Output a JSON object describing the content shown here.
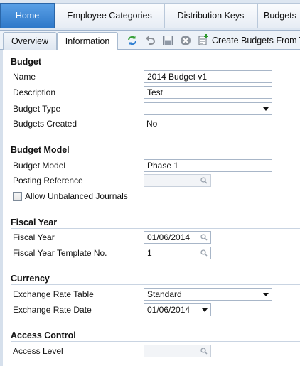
{
  "top_tabs": [
    "Home",
    "Employee Categories",
    "Distribution Keys",
    "Budgets"
  ],
  "sub_tabs": {
    "overview": "Overview",
    "information": "Information"
  },
  "toolbar": {
    "create_budgets_label": "Create Budgets From Te",
    "icons": [
      "refresh-icon",
      "undo-icon",
      "save-icon",
      "cancel-icon",
      "create-budgets-icon"
    ]
  },
  "sections": {
    "budget": {
      "title": "Budget",
      "name_label": "Name",
      "name_value": "2014 Budget v1",
      "description_label": "Description",
      "description_value": "Test",
      "budget_type_label": "Budget Type",
      "budget_type_value": "",
      "budgets_created_label": "Budgets Created",
      "budgets_created_value": "No"
    },
    "budget_model": {
      "title": "Budget Model",
      "model_label": "Budget Model",
      "model_value": "Phase 1",
      "posting_reference_label": "Posting Reference",
      "posting_reference_value": "",
      "allow_unbalanced_label": "Allow Unbalanced Journals",
      "allow_unbalanced_checked": false
    },
    "fiscal_year": {
      "title": "Fiscal Year",
      "fiscal_year_label": "Fiscal Year",
      "fiscal_year_value": "01/06/2014",
      "template_label": "Fiscal Year Template No.",
      "template_value": "1"
    },
    "currency": {
      "title": "Currency",
      "rate_table_label": "Exchange Rate Table",
      "rate_table_value": "Standard",
      "rate_date_label": "Exchange Rate Date",
      "rate_date_value": "01/06/2014"
    },
    "access_control": {
      "title": "Access Control",
      "access_level_label": "Access Level",
      "access_level_value": ""
    }
  },
  "colors": {
    "active_tab": "#3d87d6",
    "section_rule": "#c9d4e2",
    "field_border": "#a8b6c8"
  }
}
